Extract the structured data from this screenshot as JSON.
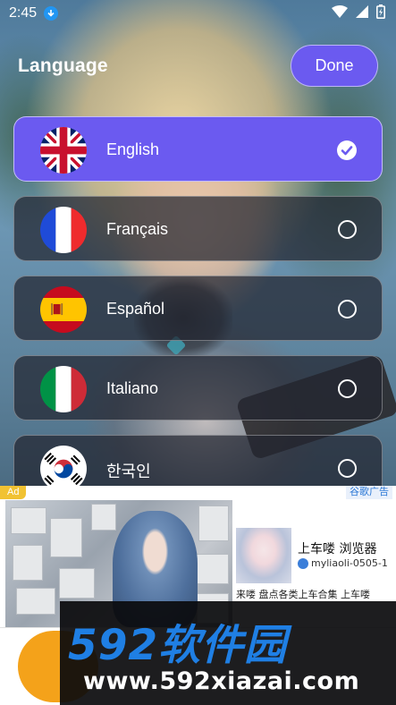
{
  "status_bar": {
    "time": "2:45",
    "icons": [
      "download-icon",
      "wifi-icon",
      "signal-icon",
      "battery-icon"
    ]
  },
  "header": {
    "title": "Language",
    "done_label": "Done"
  },
  "colors": {
    "accent": "#6b5af0",
    "item_background": "rgba(35,38,48,0.72)",
    "ad_tag": "#f1c232",
    "watermark_brand": "#1f7fe4"
  },
  "languages": [
    {
      "label": "English",
      "flag": "uk-flag-icon",
      "selected": true
    },
    {
      "label": "Français",
      "flag": "france-flag-icon",
      "selected": false
    },
    {
      "label": "Español",
      "flag": "spain-flag-icon",
      "selected": false
    },
    {
      "label": "Italiano",
      "flag": "italy-flag-icon",
      "selected": false
    },
    {
      "label": "한국인",
      "flag": "korea-flag-icon",
      "selected": false
    }
  ],
  "ad": {
    "tag": "Ad",
    "source": "谷歌广告",
    "title": "上车喽 浏览器",
    "url": "myliaoli-0505-1",
    "description": "来喽 盘点各类上车合集 上车喽"
  },
  "watermark": {
    "brand": "592软件园",
    "url": "www.592xiazai.com"
  }
}
